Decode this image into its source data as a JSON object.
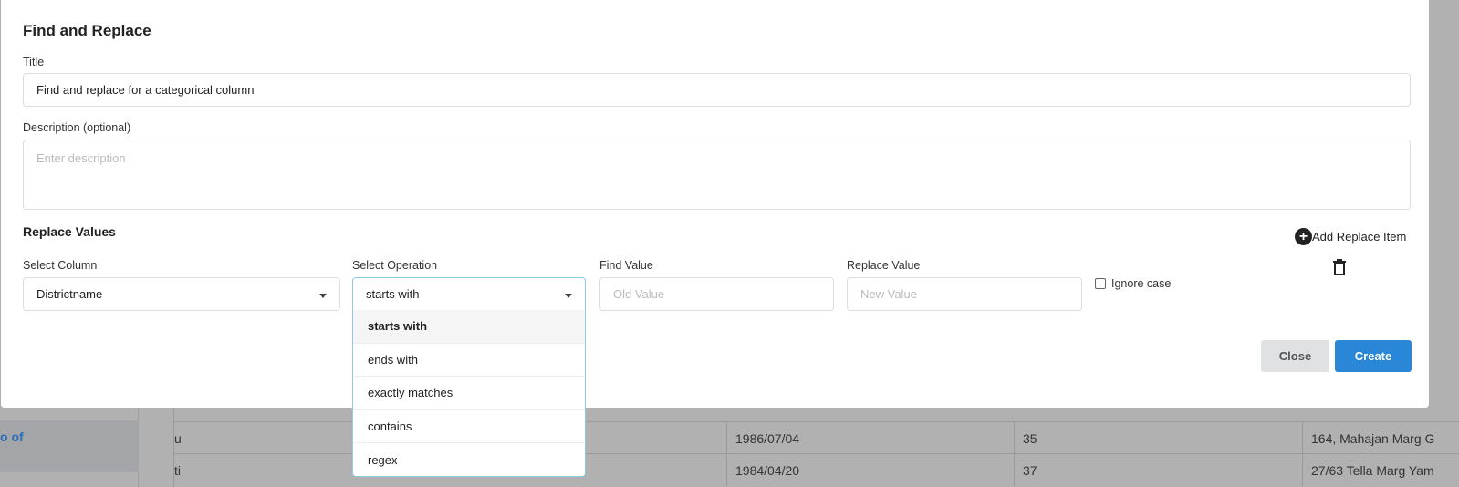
{
  "background": {
    "sidebar_item": "o of",
    "rows": [
      [
        "u",
        "1986/07/04",
        "35",
        "164, Mahajan Marg G"
      ],
      [
        "ti",
        "1984/04/20",
        "37",
        "27/63 Tella Marg Yam"
      ]
    ]
  },
  "modal": {
    "title": "Find and Replace",
    "title_label": "Title",
    "title_value": "Find and replace for a categorical  column",
    "description_label": "Description (optional)",
    "description_placeholder": "Enter description",
    "replace_values": "Replace Values",
    "add_replace_item": "Add Replace Item",
    "select_column_label": "Select Column",
    "select_column_value": "Districtname",
    "select_operation_label": "Select Operation",
    "select_operation_value": "starts with",
    "operations": [
      "starts with",
      "ends with",
      "exactly matches",
      "contains",
      "regex"
    ],
    "find_value_label": "Find Value",
    "find_value_placeholder": "Old Value",
    "replace_value_label": "Replace Value",
    "replace_value_placeholder": "New Value",
    "ignore_case": "Ignore case",
    "ignore_case_checked": false,
    "close": "Close",
    "create": "Create"
  },
  "colors": {
    "primary": "#2a86d6",
    "secondary": "#e0e1e2",
    "dropdown_border": "#8ccbe0"
  }
}
